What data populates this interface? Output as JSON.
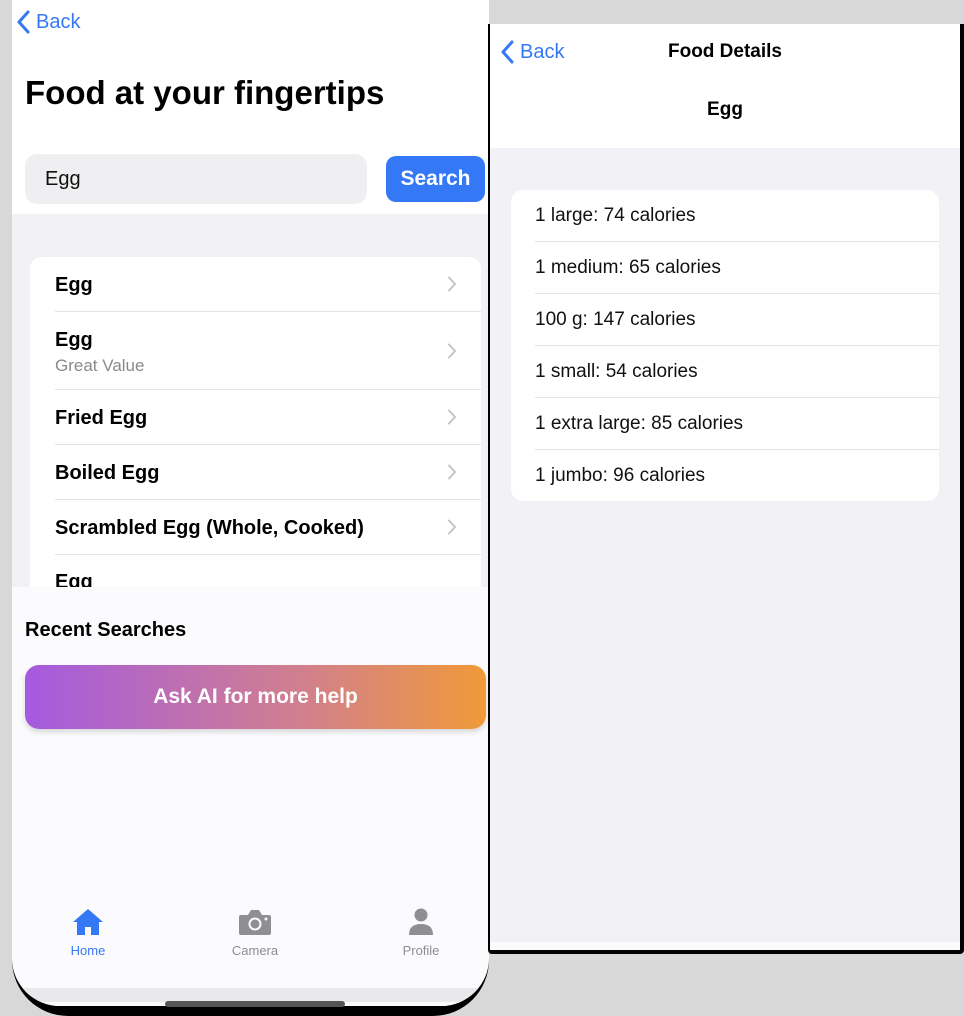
{
  "left_screen": {
    "back_label": "Back",
    "title": "Food at your fingertips",
    "search": {
      "value": "Egg",
      "button_label": "Search"
    },
    "results": [
      {
        "title": "Egg",
        "subtitle": ""
      },
      {
        "title": "Egg",
        "subtitle": "Great Value"
      },
      {
        "title": "Fried Egg",
        "subtitle": ""
      },
      {
        "title": "Boiled Egg",
        "subtitle": ""
      },
      {
        "title": "Scrambled Egg (Whole, Cooked)",
        "subtitle": ""
      },
      {
        "title": "Egg",
        "subtitle": ""
      }
    ],
    "recent_searches_title": "Recent Searches",
    "ai_button_label": "Ask AI for more help",
    "tabs": [
      {
        "label": "Home",
        "icon": "house-icon",
        "active": true
      },
      {
        "label": "Camera",
        "icon": "camera-icon",
        "active": false
      },
      {
        "label": "Profile",
        "icon": "person-icon",
        "active": false
      }
    ]
  },
  "right_screen": {
    "back_label": "Back",
    "nav_title": "Food Details",
    "food_name": "Egg",
    "servings": [
      "1 large: 74 calories",
      "1 medium: 65 calories",
      "100 g: 147 calories",
      "1 small: 54 calories",
      "1 extra large: 85 calories",
      "1 jumbo: 96 calories"
    ]
  },
  "colors": {
    "accent": "#3478f6",
    "gradient_start": "#a45ae0",
    "gradient_end": "#f09a38",
    "grouped_background": "#f2f2f6"
  }
}
